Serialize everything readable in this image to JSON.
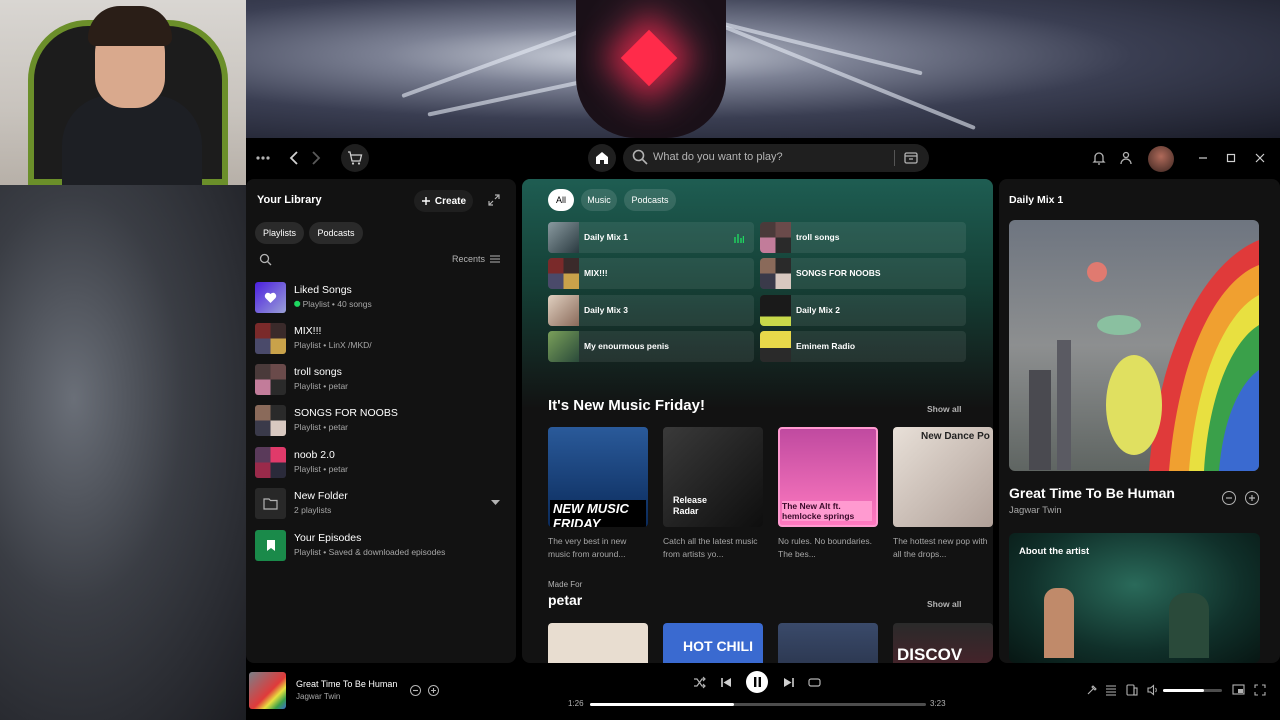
{
  "search": {
    "placeholder": "What do you want to play?"
  },
  "library": {
    "title": "Your Library",
    "create_label": "Create",
    "filters": [
      "Playlists",
      "Podcasts"
    ],
    "sort_label": "Recents",
    "items": [
      {
        "name": "Liked Songs",
        "sub": "Playlist • 40 songs"
      },
      {
        "name": "MIX!!!",
        "sub": "Playlist • LinX /MKD/"
      },
      {
        "name": "troll songs",
        "sub": "Playlist • petar"
      },
      {
        "name": "SONGS FOR NOOBS",
        "sub": "Playlist • petar"
      },
      {
        "name": "noob 2.0",
        "sub": "Playlist • petar"
      },
      {
        "name": "New Folder",
        "sub": "2 playlists"
      },
      {
        "name": "Your Episodes",
        "sub": "Playlist • Saved & downloaded episodes"
      }
    ]
  },
  "main": {
    "filters": [
      "All",
      "Music",
      "Podcasts"
    ],
    "quick": [
      {
        "label": "Daily Mix 1"
      },
      {
        "label": "troll songs"
      },
      {
        "label": "MIX!!!"
      },
      {
        "label": "SONGS FOR NOOBS"
      },
      {
        "label": "Daily Mix 3"
      },
      {
        "label": "Daily Mix 2"
      },
      {
        "label": "My enourmous penis"
      },
      {
        "label": "Eminem Radio"
      }
    ],
    "section1": {
      "title": "It's New Music Friday!",
      "show_all": "Show all",
      "albums": [
        {
          "cover_text": "NEW MUSIC FRIDAY",
          "desc": "The very best in new music from around..."
        },
        {
          "cover_text": "Release Radar",
          "desc": "Catch all the latest music from artists yo..."
        },
        {
          "cover_text": "The New Alt ft. hemlocke springs",
          "desc": "No rules. No boundaries. The bes..."
        },
        {
          "cover_text": "New Dance Po",
          "desc": "The hottest new pop with all the drops..."
        }
      ]
    },
    "section2": {
      "kicker": "Made For",
      "title": "petar",
      "show_all": "Show all",
      "cover_texts": [
        "HOT CHILI",
        "DISCOV"
      ]
    }
  },
  "right_panel": {
    "title": "Daily Mix 1",
    "song": "Great Time To Be Human",
    "artist": "Jagwar Twin",
    "about_label": "About the artist"
  },
  "player": {
    "song": "Great Time To Be Human",
    "artist": "Jagwar Twin",
    "elapsed": "1:26",
    "total": "3:23",
    "progress": 0.43,
    "volume": 0.7
  },
  "colors": {
    "accent": "#1ed760",
    "bg": "#121212",
    "main_gradient": "#1e5d52"
  }
}
